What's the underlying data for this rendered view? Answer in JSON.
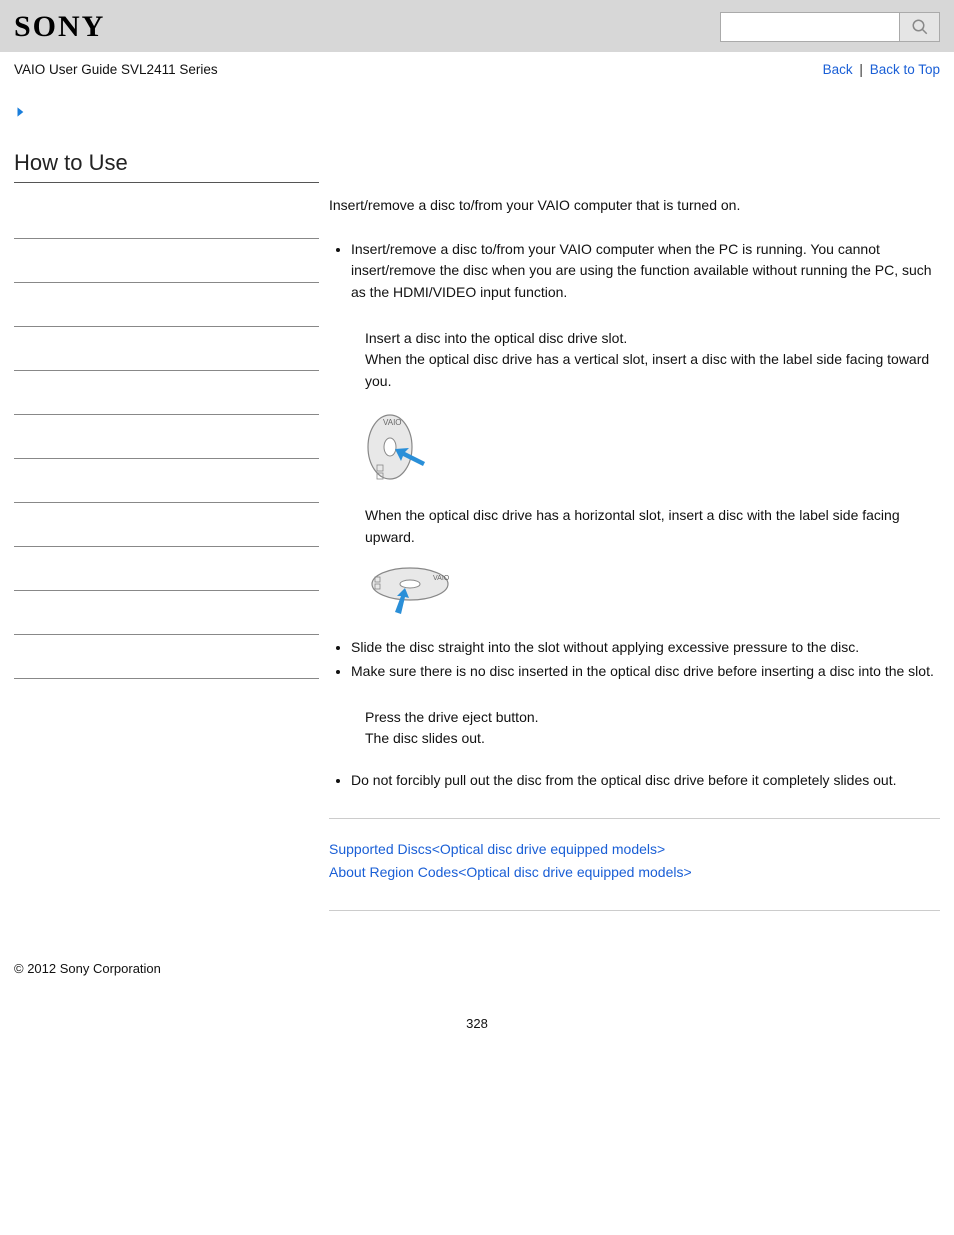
{
  "header": {
    "logo_text": "SONY",
    "search_placeholder": ""
  },
  "subheader": {
    "guide_title": "VAIO User Guide SVL2411 Series",
    "back_label": "Back",
    "top_label": "Back to Top",
    "separator": "|"
  },
  "sidebar": {
    "title": "How to Use",
    "nav_row_count": 11
  },
  "main": {
    "intro": "Insert/remove a disc to/from your VAIO computer that is turned on.",
    "bullet_running": "Insert/remove a disc to/from your VAIO computer when the PC is running. You cannot insert/remove the disc when you are using the function available without running the PC, such as the HDMI/VIDEO input function.",
    "step_insert1": "Insert a disc into the optical disc drive slot.",
    "step_insert2": "When the optical disc drive has a vertical slot, insert a disc with the label side facing toward you.",
    "step_horizontal": "When the optical disc drive has a horizontal slot, insert a disc with the label side facing upward.",
    "bullet_slide": "Slide the disc straight into the slot without applying excessive pressure to the disc.",
    "bullet_nodisc": "Make sure there is no disc inserted in the optical disc drive before inserting a disc into the slot.",
    "step_eject1": "Press the drive eject button.",
    "step_eject2": "The disc slides out.",
    "bullet_noforce": "Do not forcibly pull out the disc from the optical disc drive before it completely slides out.",
    "related": {
      "link1": "Supported Discs<Optical disc drive equipped models>",
      "link2": "About Region Codes<Optical disc drive equipped models>"
    }
  },
  "footer": {
    "copyright": "© 2012 Sony Corporation",
    "page_number": "328"
  }
}
